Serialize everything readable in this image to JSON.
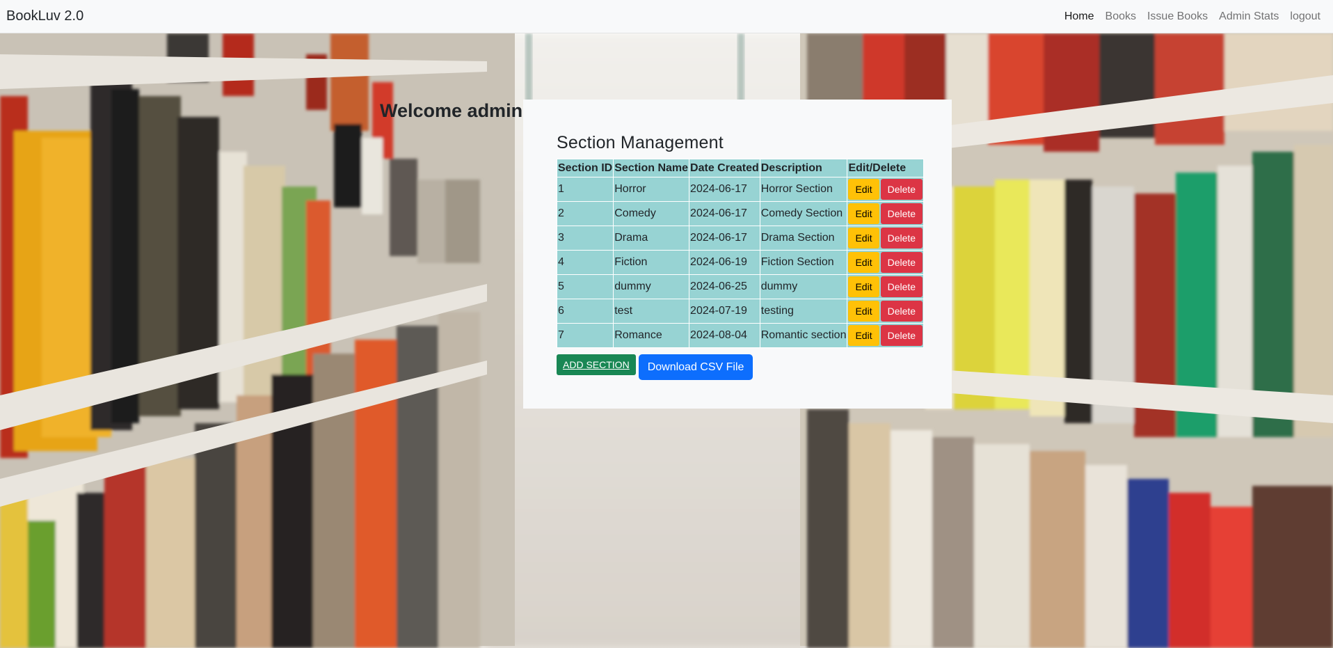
{
  "navbar": {
    "brand": "BookLuv 2.0",
    "links": [
      {
        "label": "Home",
        "active": true
      },
      {
        "label": "Books"
      },
      {
        "label": "Issue Books"
      },
      {
        "label": "Admin Stats"
      },
      {
        "label": "logout"
      }
    ]
  },
  "welcome": "Welcome admin",
  "card": {
    "title": "Section Management",
    "headers": [
      "Section ID",
      "Section Name",
      "Date Created",
      "Description",
      "Edit/Delete"
    ],
    "rows": [
      {
        "id": "1",
        "name": "Horror",
        "date": "2024-06-17",
        "description": "Horror Section"
      },
      {
        "id": "2",
        "name": "Comedy",
        "date": "2024-06-17",
        "description": "Comedy Section"
      },
      {
        "id": "3",
        "name": "Drama",
        "date": "2024-06-17",
        "description": "Drama Section"
      },
      {
        "id": "4",
        "name": "Fiction",
        "date": "2024-06-19",
        "description": "Fiction Section"
      },
      {
        "id": "5",
        "name": "dummy",
        "date": "2024-06-25",
        "description": "dummy"
      },
      {
        "id": "6",
        "name": "test",
        "date": "2024-07-19",
        "description": "testing"
      },
      {
        "id": "7",
        "name": "Romance",
        "date": "2024-08-04",
        "description": "Romantic section"
      }
    ],
    "edit_label": "Edit",
    "delete_label": "Delete",
    "add_label": "ADD SECTION",
    "csv_label": "Download CSV File"
  },
  "colors": {
    "table_cell": "#97d3d3",
    "edit": "#ffc107",
    "delete": "#dc3545",
    "add": "#198754",
    "csv": "#0d6efd"
  }
}
